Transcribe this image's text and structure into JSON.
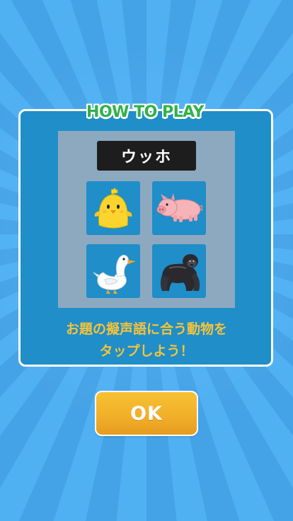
{
  "dialog": {
    "title": "HOW TO PLAY",
    "prompt_word": "ウッホ",
    "instruction_line1": "お題の擬声語に合う動物を",
    "instruction_line2": "タップしよう！",
    "ok_label": "OK"
  },
  "choices": [
    {
      "animal": "chick-icon"
    },
    {
      "animal": "pig-icon"
    },
    {
      "animal": "duck-icon"
    },
    {
      "animal": "gorilla-icon"
    }
  ],
  "colors": {
    "background": "#4aa6ea",
    "panel": "#1f8ec9",
    "inner_board": "#8da9c0",
    "title_green": "#2fb24a",
    "instruction_yellow": "#f5c33a",
    "ok_button": "#f2b02a"
  }
}
